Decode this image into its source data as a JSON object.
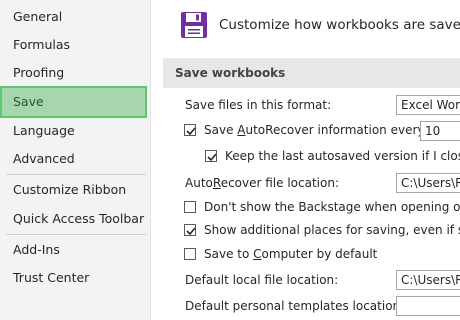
{
  "sidebar": {
    "items": [
      {
        "label": "General"
      },
      {
        "label": "Formulas"
      },
      {
        "label": "Proofing"
      },
      {
        "label": "Save",
        "selected": true
      },
      {
        "label": "Language"
      },
      {
        "label": "Advanced"
      },
      {
        "label": "Customize Ribbon"
      },
      {
        "label": "Quick Access Toolbar"
      },
      {
        "label": "Add-Ins"
      },
      {
        "label": "Trust Center"
      }
    ]
  },
  "main": {
    "banner_title": "Customize how workbooks are saved.",
    "section_header": "Save workbooks",
    "save_format": {
      "label": "Save files in this format:",
      "value": "Excel Work"
    },
    "autorecover": {
      "label_pre": "Save ",
      "label_u": "A",
      "label_post": "utoRecover information every",
      "checked": true,
      "value": "10"
    },
    "keep_last": {
      "label": "Keep the last autosaved version if I close w",
      "checked": true
    },
    "autorecover_location": {
      "label_pre": "Auto",
      "label_u": "R",
      "label_post": "ecover file location:",
      "value": "C:\\Users\\Ra"
    },
    "dont_show_backstage": {
      "label": "Don't show the Backstage when opening or sa",
      "checked": false
    },
    "show_additional": {
      "label": "Show additional places for saving, even if sign",
      "checked": true
    },
    "save_to_computer": {
      "label_pre": "Save to ",
      "label_u": "C",
      "label_post": "omputer by default",
      "checked": false
    },
    "default_local": {
      "label": "Default local file location:",
      "value": "C:\\Users\\Ra"
    },
    "default_templates": {
      "label": "Default personal templates location:",
      "value": ""
    }
  },
  "colors": {
    "selected_bg": "#a6d5b0",
    "selected_border": "#5ec86c",
    "save_icon": "#7030a0",
    "sidebar_bg": "#f3f3f3"
  },
  "icons": {
    "banner": "floppy-disk-icon",
    "checkmark": "checkmark-icon"
  }
}
